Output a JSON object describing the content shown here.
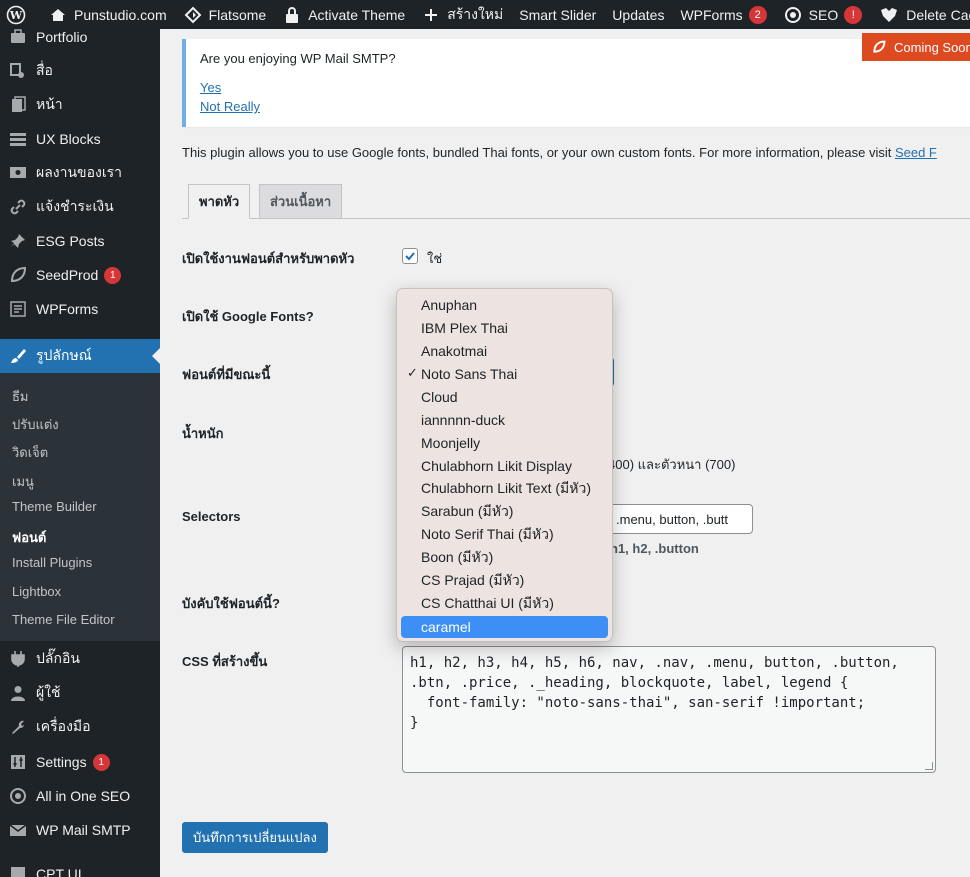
{
  "adminbar": {
    "site": "Punstudio.com",
    "items": [
      {
        "label": "Flatsome"
      },
      {
        "label": "Activate Theme"
      },
      {
        "label": "สร้างใหม่"
      },
      {
        "label": "Smart Slider"
      },
      {
        "label": "Updates"
      },
      {
        "label": "WPForms",
        "badge": "2"
      },
      {
        "label": "SEO",
        "badge": "!"
      },
      {
        "label": "Delete Cache"
      }
    ]
  },
  "sidebar": {
    "items": [
      {
        "label": "Portfolio"
      },
      {
        "label": "สื่อ"
      },
      {
        "label": "หน้า"
      },
      {
        "label": "UX Blocks"
      },
      {
        "label": "ผลงานของเรา"
      },
      {
        "label": "แจ้งชำระเงิน"
      },
      {
        "label": "ESG Posts"
      },
      {
        "label": "SeedProd",
        "count": "1"
      },
      {
        "label": "WPForms"
      },
      {
        "label": "รูปลักษณ์"
      },
      {
        "label": "ปลั๊กอิน"
      },
      {
        "label": "ผู้ใช้"
      },
      {
        "label": "เครื่องมือ"
      },
      {
        "label": "Settings",
        "count": "1"
      },
      {
        "label": "All in One SEO"
      },
      {
        "label": "WP Mail SMTP"
      },
      {
        "label": "CPT UI"
      }
    ],
    "submenu": [
      "ธีม",
      "ปรับแต่ง",
      "วิดเจ็ต",
      "เมนู",
      "Theme Builder",
      "ฟอนต์",
      "Install Plugins",
      "Lightbox",
      "Theme File Editor"
    ]
  },
  "notice": {
    "question": "Are you enjoying WP Mail SMTP?",
    "yes": "Yes",
    "no": "Not Really"
  },
  "coming_soon": "Coming Soon",
  "description": {
    "text": "This plugin allows you to use Google fonts, bundled Thai fonts, or your own custom fonts. For more information, please visit ",
    "link": "Seed F"
  },
  "tabs": [
    "พาดหัว",
    "ส่วนเนื้อหา"
  ],
  "form": {
    "enable_label": "เปิดใช้งานฟอนต์สำหรับพาดหัว",
    "enable_value": "ใช่",
    "google_label": "เปิดใช้ Google Fonts?",
    "font_label": "ฟอนต์ที่มีขณะนี้",
    "weight_label": "น้ำหนัก",
    "weight_text": "400) และตัวหนา (700)",
    "selectors_label": "Selectors",
    "selectors_value": ".menu, button, .butt",
    "selectors_hint": "h1, h2, .button",
    "force_label": "บังคับใช้ฟอนต์นี้?",
    "css_label": "CSS ที่สร้างขึ้น",
    "css_value": "h1, h2, h3, h4, h5, h6, nav, .nav, .menu, button, .button,\n.btn, .price, ._heading, blockquote, label, legend {\n  font-family: \"noto-sans-thai\", san-serif !important;\n}",
    "save_label": "บันทึกการเปลี่ยนแปลง"
  },
  "dropdown": {
    "options": [
      "Anuphan",
      "IBM Plex Thai",
      "Anakotmai",
      "Noto Sans Thai",
      "Cloud",
      "iannnnn-duck",
      "Moonjelly",
      "Chulabhorn Likit Display",
      "Chulabhorn Likit Text (มีหัว)",
      "Sarabun (มีหัว)",
      "Noto Serif Thai (มีหัว)",
      "Boon (มีหัว)",
      "CS Prajad (มีหัว)",
      "CS Chatthai UI (มีหัว)",
      "caramel"
    ],
    "checked": "Noto Sans Thai",
    "highlighted": "caramel",
    "check_mark": "✓"
  },
  "colors": {
    "admin_bg": "#1d2327",
    "accent": "#2271b1",
    "badge": "#d63638",
    "coming_soon": "#dd4a1f",
    "dropdown_highlight": "#3d8ff5"
  }
}
